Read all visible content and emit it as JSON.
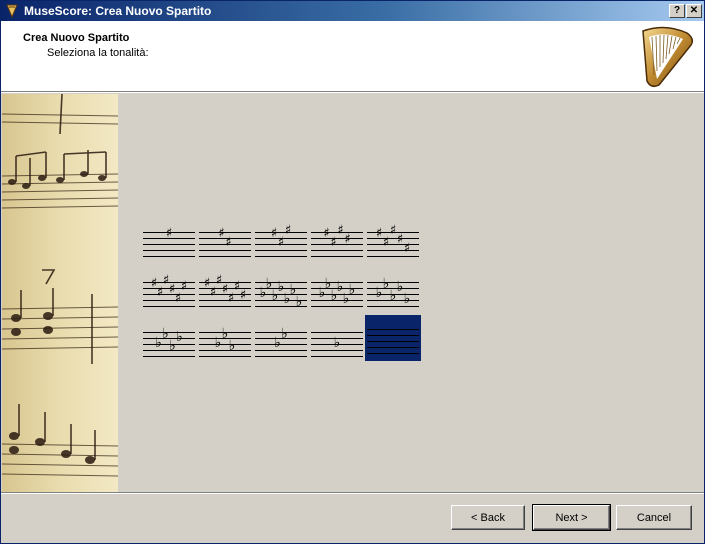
{
  "window": {
    "title": "MuseScore: Crea Nuovo Spartito",
    "help_label": "?",
    "close_label": "✕"
  },
  "header": {
    "title": "Crea Nuovo Spartito",
    "subtitle": "Seleziona la tonalità:"
  },
  "key_signatures": [
    {
      "accidental": "sharp",
      "count": 1
    },
    {
      "accidental": "sharp",
      "count": 2
    },
    {
      "accidental": "sharp",
      "count": 3
    },
    {
      "accidental": "sharp",
      "count": 4
    },
    {
      "accidental": "sharp",
      "count": 5
    },
    {
      "accidental": "sharp",
      "count": 6
    },
    {
      "accidental": "sharp",
      "count": 7
    },
    {
      "accidental": "flat",
      "count": 7
    },
    {
      "accidental": "flat",
      "count": 6
    },
    {
      "accidental": "flat",
      "count": 5
    },
    {
      "accidental": "flat",
      "count": 4
    },
    {
      "accidental": "flat",
      "count": 3
    },
    {
      "accidental": "flat",
      "count": 2
    },
    {
      "accidental": "flat",
      "count": 1
    },
    {
      "accidental": "none",
      "count": 0,
      "selected": true
    }
  ],
  "selection_color": "#0a246a",
  "buttons": {
    "back": "< Back",
    "next": "Next >",
    "cancel": "Cancel"
  }
}
